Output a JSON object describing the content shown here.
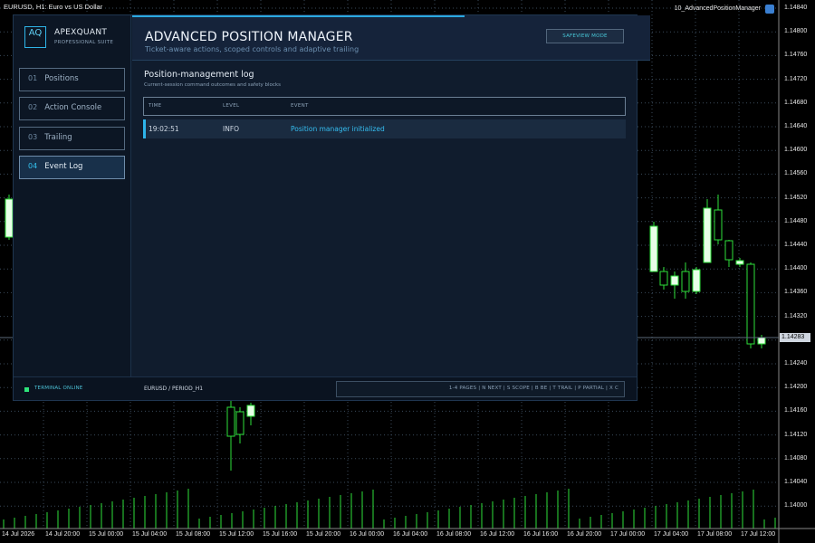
{
  "chart": {
    "title": "EURUSD, H1: Euro vs US Dollar",
    "expert_name": "10_AdvancedPositionManager",
    "current_price": "1.14283",
    "price_axis": [
      "1.14840",
      "1.14800",
      "1.14760",
      "1.14720",
      "1.14680",
      "1.14640",
      "1.14600",
      "1.14560",
      "1.14520",
      "1.14480",
      "1.14440",
      "1.14400",
      "1.14360",
      "1.14320",
      "1.14280",
      "1.14240",
      "1.14200",
      "1.14160",
      "1.14120",
      "1.14080",
      "1.14040",
      "1.14000"
    ],
    "time_axis": [
      "14 Jul 2026",
      "14 Jul 20:00",
      "15 Jul 00:00",
      "15 Jul 04:00",
      "15 Jul 08:00",
      "15 Jul 12:00",
      "15 Jul 16:00",
      "15 Jul 20:00",
      "16 Jul 00:00",
      "16 Jul 04:00",
      "16 Jul 08:00",
      "16 Jul 12:00",
      "16 Jul 16:00",
      "16 Jul 20:00",
      "17 Jul 00:00",
      "17 Jul 04:00",
      "17 Jul 08:00",
      "17 Jul 12:00"
    ],
    "colors": {
      "bull": "#e8ffe8",
      "bear": "#000000",
      "wick": "#2ee03a",
      "grid": "#3a4a5a",
      "volume": "#2ee03a"
    }
  },
  "sidebar": {
    "logo": "AQ",
    "brand": "APEXQUANT",
    "brand_sub": "PROFESSIONAL SUITE",
    "items": [
      {
        "num": "01",
        "label": "Positions"
      },
      {
        "num": "02",
        "label": "Action Console"
      },
      {
        "num": "03",
        "label": "Trailing"
      },
      {
        "num": "04",
        "label": "Event Log"
      }
    ],
    "active_index": 3
  },
  "header": {
    "title": "ADVANCED POSITION MANAGER",
    "subtitle": "Ticket-aware actions, scoped controls and adaptive trailing",
    "mode_button": "SAFEVIEW MODE"
  },
  "log": {
    "title": "Position-management log",
    "subtitle": "Current-session command outcomes and safety blocks",
    "columns": [
      "TIME",
      "LEVEL",
      "EVENT"
    ],
    "rows": [
      {
        "time": "19:02:51",
        "level": "INFO",
        "event": "Position manager initialized"
      }
    ]
  },
  "footer": {
    "status": "TERMINAL ONLINE",
    "symbol": "EURUSD / PERIOD_H1",
    "shortcuts": "1-4 PAGES | N NEXT | S SCOPE | B BE | T TRAIL | P PARTIAL | X C"
  },
  "accent": "#2eb4ea"
}
